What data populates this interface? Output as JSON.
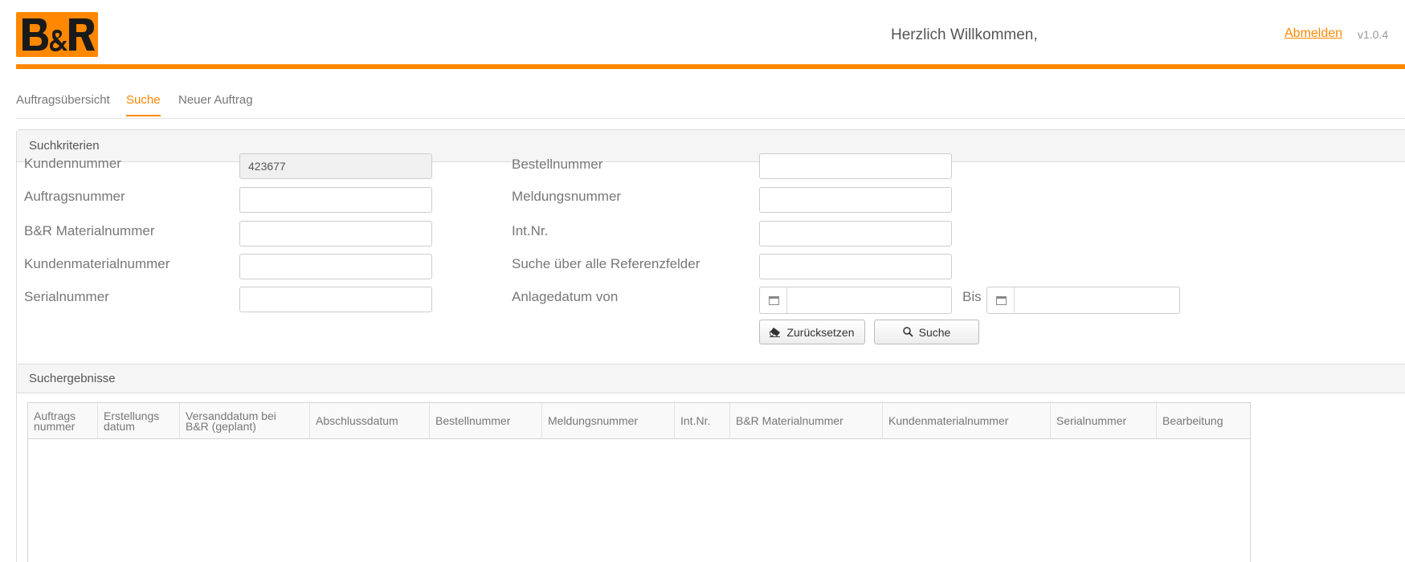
{
  "header": {
    "logo_text": "B&R",
    "welcome": "Herzlich Willkommen,",
    "logout": "Abmelden",
    "version": "v1.0.4",
    "accent_color": "#ff8800"
  },
  "tabs": [
    {
      "label": "Auftragsübersicht",
      "active": false
    },
    {
      "label": "Suche",
      "active": true
    },
    {
      "label": "Neuer Auftrag",
      "active": false
    }
  ],
  "criteria": {
    "title": "Suchkriterien",
    "left_fields": [
      {
        "label": "Kundennummer",
        "value": "423677",
        "readonly": true
      },
      {
        "label": "Auftragsnummer",
        "value": ""
      },
      {
        "label": "B&R Materialnummer",
        "value": ""
      },
      {
        "label": "Kundenmaterialnummer",
        "value": ""
      },
      {
        "label": "Serialnummer",
        "value": ""
      }
    ],
    "right_fields": [
      {
        "label": "Bestellnummer",
        "value": ""
      },
      {
        "label": "Meldungsnummer",
        "value": ""
      },
      {
        "label": "Int.Nr.",
        "value": ""
      },
      {
        "label": "Suche über alle Referenzfelder",
        "value": ""
      }
    ],
    "date_label": "Anlagedatum von",
    "bis_label": "Bis",
    "calendar_icon": "calendar-icon",
    "reset_label": "Zurücksetzen",
    "reset_icon": "eraser-icon",
    "search_label": "Suche",
    "search_icon": "search-icon"
  },
  "results": {
    "title": "Suchergebnisse",
    "columns": [
      [
        "Auftrags",
        "nummer"
      ],
      [
        "Erstellungs",
        "datum"
      ],
      [
        "Versanddatum bei",
        "B&R (geplant)"
      ],
      [
        "Abschlussdatum"
      ],
      [
        "Bestellnummer"
      ],
      [
        "Meldungsnummer"
      ],
      [
        "Int.Nr."
      ],
      [
        "B&R Materialnummer"
      ],
      [
        "Kundenmaterialnummer"
      ],
      [
        "Serialnummer"
      ],
      [
        "Bearbeitung"
      ]
    ]
  }
}
